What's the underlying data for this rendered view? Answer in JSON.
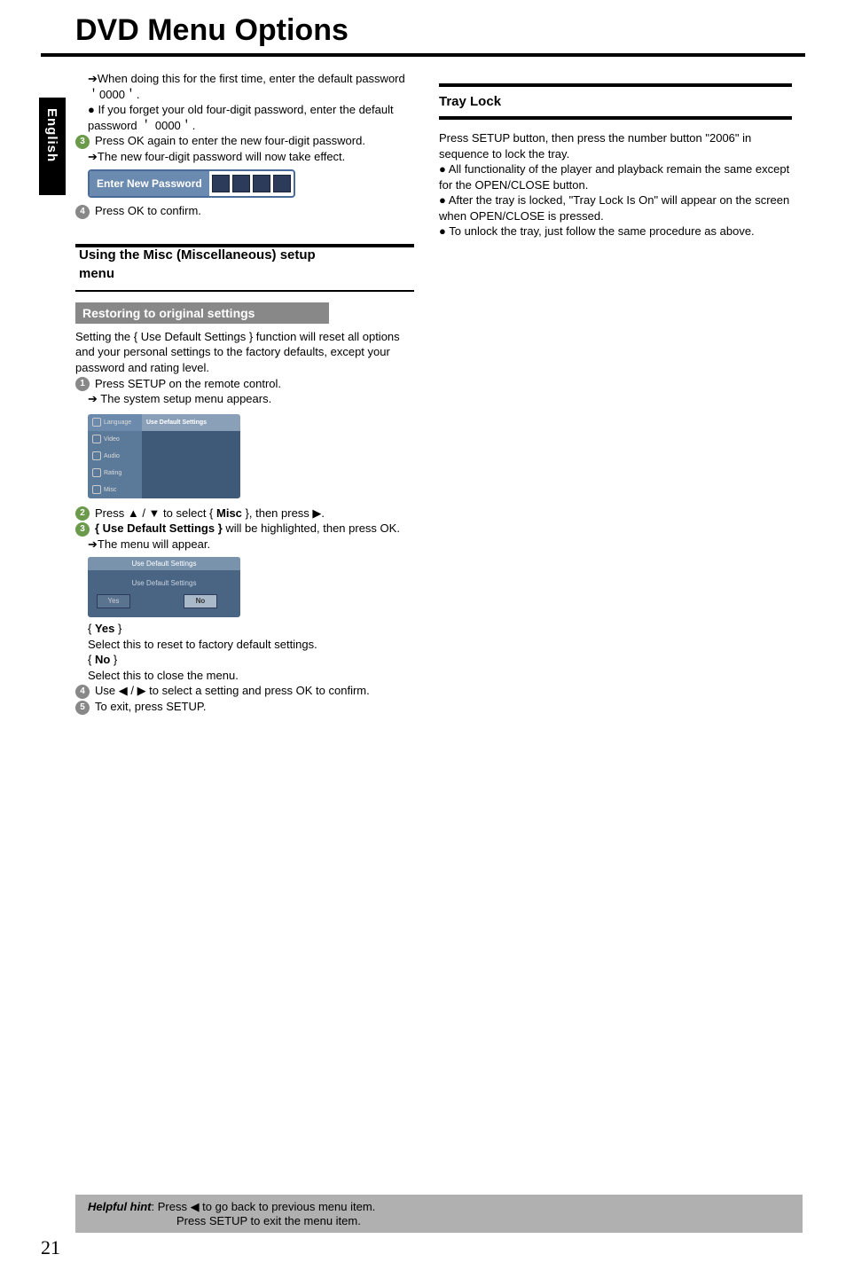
{
  "title": "DVD Menu Options",
  "sideTabLabel": "English",
  "pageNumber": "21",
  "left": {
    "intro": {
      "arrow1": "➔When doing this for the first time, enter the default password ＇0000＇.",
      "bullet1": "● If you forget your old four-digit password, enter the default  password ＇ 0000＇.",
      "step3": "Press OK again to enter the new four-digit password.",
      "arrow2": "➔The new four-digit password will now take effect.",
      "passwordBoxLabel": "Enter New Password",
      "step4": "Press OK to confirm."
    },
    "miscTitleLine1": "Using the Misc (Miscellaneous) setup",
    "miscTitleLine2": "menu",
    "restoreTab": "Restoring to original settings",
    "restoreIntro": "Setting the { Use Default Settings } function will reset all options and your personal settings to the factory defaults, except your password and rating level.",
    "r_step1": "Press SETUP on the remote control.",
    "r_step1_arrow": "➔ The system setup menu appears.",
    "ms_rows": [
      {
        "left": "Language",
        "right": "Use Default Settings",
        "sel": true
      },
      {
        "left": "Video",
        "right": "",
        "sel": false
      },
      {
        "left": "Audio",
        "right": "",
        "sel": false
      },
      {
        "left": "Rating",
        "right": "",
        "sel": false
      },
      {
        "left": "Misc",
        "right": "",
        "sel": false
      }
    ],
    "r_step2_pre": "Press ▲ / ▼ to select { ",
    "r_step2_misc": "Misc",
    "r_step2_post": " }, then press ▶.",
    "r_step3_bold": "{ Use Default Settings }",
    "r_step3_rest": " will be highlighted, then press OK.",
    "r_step3_arrow": "➔The menu will appear.",
    "cs_header": "Use Default Settings",
    "cs_body": "Use Default Settings",
    "cs_yes": "Yes",
    "cs_no": "No",
    "yes_label": "Yes",
    "yes_desc": "Select this to reset to factory default settings.",
    "no_label": "No",
    "no_desc": "Select this to close the menu.",
    "r_step4": "Use ◀ / ▶ to select a setting and press OK to confirm.",
    "r_step5": "To exit, press SETUP."
  },
  "right": {
    "trayLockTitle": "Tray Lock",
    "p1": "Press SETUP button, then press the number button \"2006\" in sequence to lock the tray.",
    "p2": "● All functionality of the player and playback remain the same except for the OPEN/CLOSE button.",
    "p3": "● After the tray is locked, \"Tray Lock Is On\" will appear on the screen when OPEN/CLOSE is pressed.",
    "p4": "● To unlock the tray, just follow the same procedure as above."
  },
  "footer": {
    "label": "Helpful hint",
    "line1": ":   Press ◀ to go back to previous menu item.",
    "line2": "Press SETUP to exit the menu item."
  }
}
